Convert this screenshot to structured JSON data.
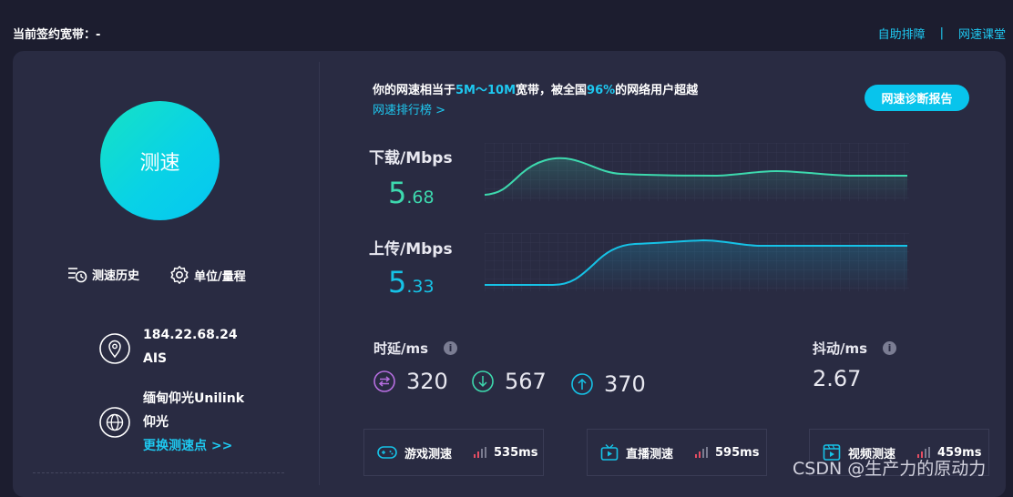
{
  "header": {
    "plan_label": "当前签约宽带：-",
    "links": {
      "self_help": "自助排障",
      "separator": "|",
      "course": "网速课堂"
    }
  },
  "speed_button": {
    "label": "测速"
  },
  "tools": {
    "history": "测速历史",
    "units": "单位/量程"
  },
  "network": {
    "ip": "184.22.68.24",
    "isp": "AIS"
  },
  "server": {
    "name_line1": "缅甸仰光Unilink",
    "name_line2": "仰光",
    "change_link": "更换测速点 >>"
  },
  "summary": {
    "prefix": "你的网速相当于",
    "bandwidth": "5M～10M",
    "middle": "宽带，被全国",
    "percent": "96%",
    "suffix": "的网络用户超越",
    "rank_link": "网速排行榜 >"
  },
  "report_button": "网速诊断报告",
  "download": {
    "label": "下载/Mbps",
    "int": "5",
    "dec": ".68",
    "color": "#3dd9ae"
  },
  "upload": {
    "label": "上传/Mbps",
    "int": "5",
    "dec": ".33",
    "color": "#16c2e6"
  },
  "latency": {
    "label": "时延/ms",
    "help_icon": "i",
    "values": {
      "total": "320",
      "down": "567",
      "up": "370"
    },
    "colors": {
      "total": "#b66ee0",
      "down": "#3dd9ae",
      "up": "#16c2e6"
    }
  },
  "jitter": {
    "label": "抖动/ms",
    "help_icon": "i",
    "value": "2.67"
  },
  "scenes": [
    {
      "label": "游戏测速",
      "value": "535ms",
      "icon": "gamepad-icon"
    },
    {
      "label": "直播测速",
      "value": "595ms",
      "icon": "tv-icon"
    },
    {
      "label": "视频测速",
      "value": "459ms",
      "icon": "video-icon"
    }
  ],
  "signal_colors": {
    "strong": "#e54d63",
    "weak": "#7a7c90"
  },
  "watermark": "CSDN @生产力的原动力"
}
